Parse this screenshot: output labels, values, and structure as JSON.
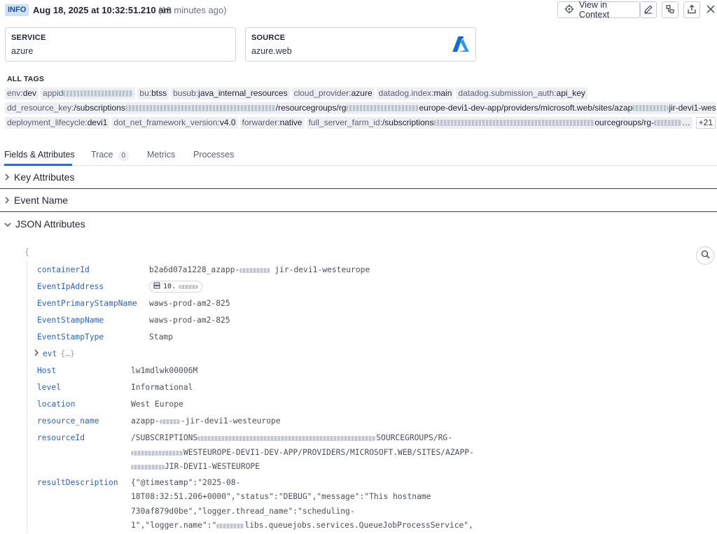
{
  "header": {
    "level": "INFO",
    "timestamp": "Aug 18, 2025 at 10:32:51.210 am",
    "relative": "(13 minutes ago)",
    "view_in_context": "View in Context"
  },
  "cards": {
    "service": {
      "label": "SERVICE",
      "value": "azure"
    },
    "source": {
      "label": "SOURCE",
      "value": "azure.web"
    }
  },
  "tags": {
    "label": "ALL TAGS",
    "row1": [
      {
        "k": "env:",
        "v": "dev"
      },
      {
        "k": "appid",
        "v": ""
      },
      {
        "k": "bu:",
        "v": "btss"
      },
      {
        "k": "busub:",
        "v": "java_internal_resources"
      },
      {
        "k": "cloud_provider:",
        "v": "azure"
      },
      {
        "k": "datadog.index:",
        "v": "main"
      },
      {
        "k": "datadog.submission_auth:",
        "v": "api_key"
      }
    ],
    "row2": {
      "k": "dd_resource_key:",
      "v1": "/subscriptions",
      "v2": "/resourcegroups/rg",
      "v3": "europe-devi1-dev-app/providers/microsoft.web/sites/azap",
      "v4": "jir-devi1-wes…"
    },
    "row3": [
      {
        "k": "deployment_lifecycle:",
        "v": "devi1"
      },
      {
        "k": "dot_net_framework_version:",
        "v": "v4.0"
      },
      {
        "k": "forwarder:",
        "v": "native"
      }
    ],
    "row3_farm": {
      "k": "full_server_farm_id:",
      "v1": "/subscriptions",
      "v2": "ourcegroups/rg-",
      "v3": "…"
    },
    "more": "+21"
  },
  "tabs": {
    "fields": "Fields & Attributes",
    "trace": "Trace",
    "trace_count": "0",
    "metrics": "Metrics",
    "processes": "Processes"
  },
  "sections": {
    "key_attributes": "Key Attributes",
    "event_name": "Event Name",
    "json_attributes": "JSON Attributes"
  },
  "json": {
    "open_brace": "{",
    "containerId": {
      "key": "containerId",
      "value_a": "b2a6d07a1228_azapp-",
      "value_b": "jir-devi1-westeurope"
    },
    "EventIpAddress": {
      "key": "EventIpAddress",
      "value": "10."
    },
    "EventPrimaryStampName": {
      "key": "EventPrimaryStampName",
      "value": "waws-prod-am2-825"
    },
    "EventStampName": {
      "key": "EventStampName",
      "value": "waws-prod-am2-825"
    },
    "EventStampType": {
      "key": "EventStampType",
      "value": "Stamp"
    },
    "evt": {
      "key": "evt",
      "ellipsis": "{…}"
    },
    "Host": {
      "key": "Host",
      "value": "lw1mdlwk00006M"
    },
    "level": {
      "key": "level",
      "value": "Informational"
    },
    "location": {
      "key": "location",
      "value": "West Europe"
    },
    "resource_name": {
      "key": "resource_name",
      "value_a": "azapp-",
      "value_b": "-jir-devi1-westeurope"
    },
    "resourceId": {
      "key": "resourceId",
      "line1_a": "/SUBSCRIPTIONS",
      "line1_b": "SOURCEGROUPS/RG-",
      "line2": "WESTEUROPE-DEVI1-DEV-APP/PROVIDERS/MICROSOFT.WEB/SITES/AZAPP-",
      "line3": "JIR-DEVI1-WESTEUROPE"
    },
    "resultDescription": {
      "key": "resultDescription",
      "line1": "{\"@timestamp\":\"2025-08-",
      "line2": "18T08:32:51.206+0000\",\"status\":\"DEBUG\",\"message\":\"This hostname",
      "line3": "730af879d0be\",\"logger.thread_name\":\"scheduling-",
      "line4_a": "1\",\"logger.name\":\"",
      "line4_b": "libs.queuejobs.services.QueueJobProcessService\","
    }
  },
  "colors": {
    "accent": "#3a67c9",
    "key": "#2a63c2",
    "azure_blue": "#0a6fd1"
  }
}
